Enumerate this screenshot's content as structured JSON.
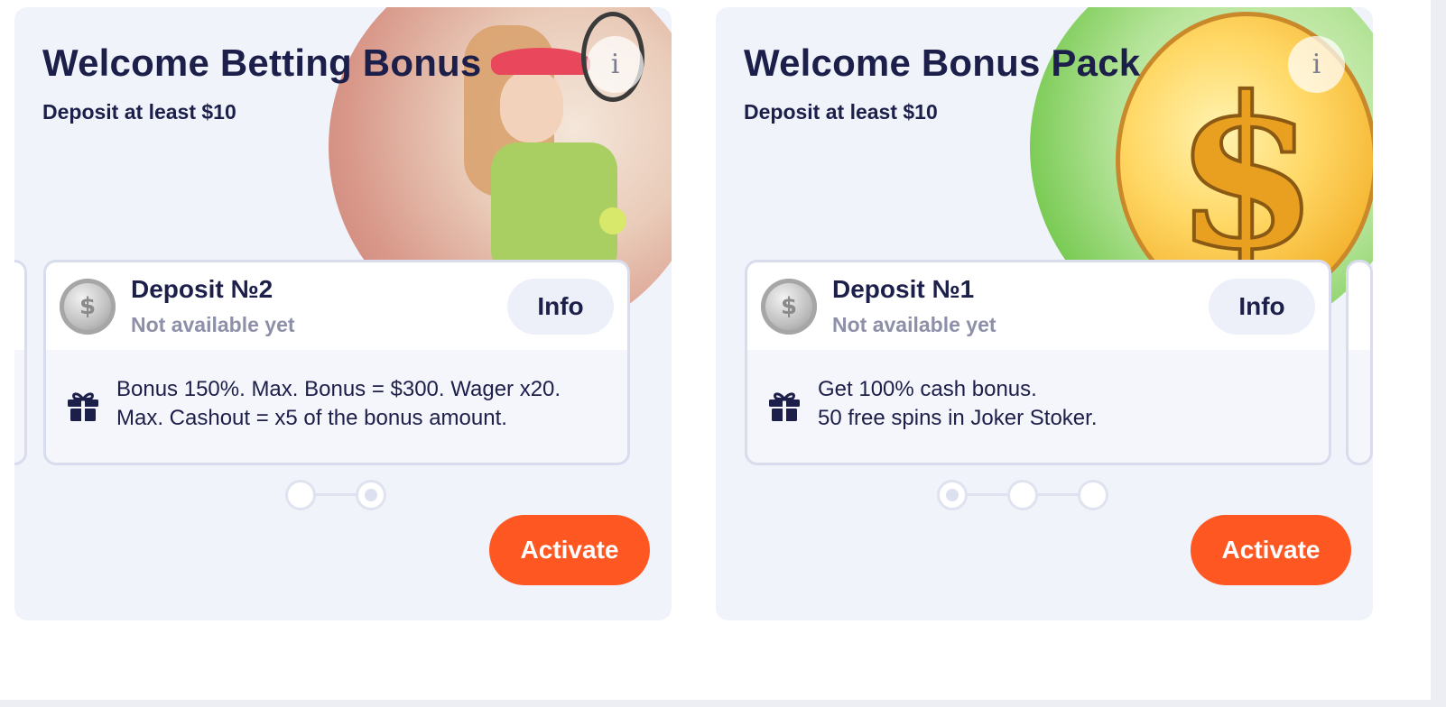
{
  "cards": [
    {
      "title": "Welcome Betting Bonus",
      "subtitle": "Deposit at least $10",
      "info_icon_glyph": "i",
      "art": "tennis-player-illustration",
      "deposit": {
        "title": "Deposit №2",
        "status": "Not available yet",
        "info_label": "Info",
        "coin_glyph": "$",
        "bonus_line_1": "Bonus 150%. Max. Bonus = $300. Wager x20.",
        "bonus_line_2": "Max. Cashout = x5 of the bonus amount."
      },
      "steps_total": 2,
      "active_step": 2,
      "activate_label": "Activate"
    },
    {
      "title": "Welcome Bonus Pack",
      "subtitle": "Deposit at least $10",
      "info_icon_glyph": "i",
      "art": "gold-coin-illustration",
      "art_glyph": "$",
      "deposit": {
        "title": "Deposit №1",
        "status": "Not available yet",
        "info_label": "Info",
        "coin_glyph": "$",
        "bonus_line_1": "Get 100% cash bonus.",
        "bonus_line_2": "50 free spins in Joker Stoker."
      },
      "steps_total": 3,
      "active_step": 1,
      "activate_label": "Activate"
    }
  ],
  "colors": {
    "accent": "#ff5722",
    "text_primary": "#1c1f4a",
    "text_muted": "#8d90a8",
    "card_bg": "#f1f3fb"
  }
}
